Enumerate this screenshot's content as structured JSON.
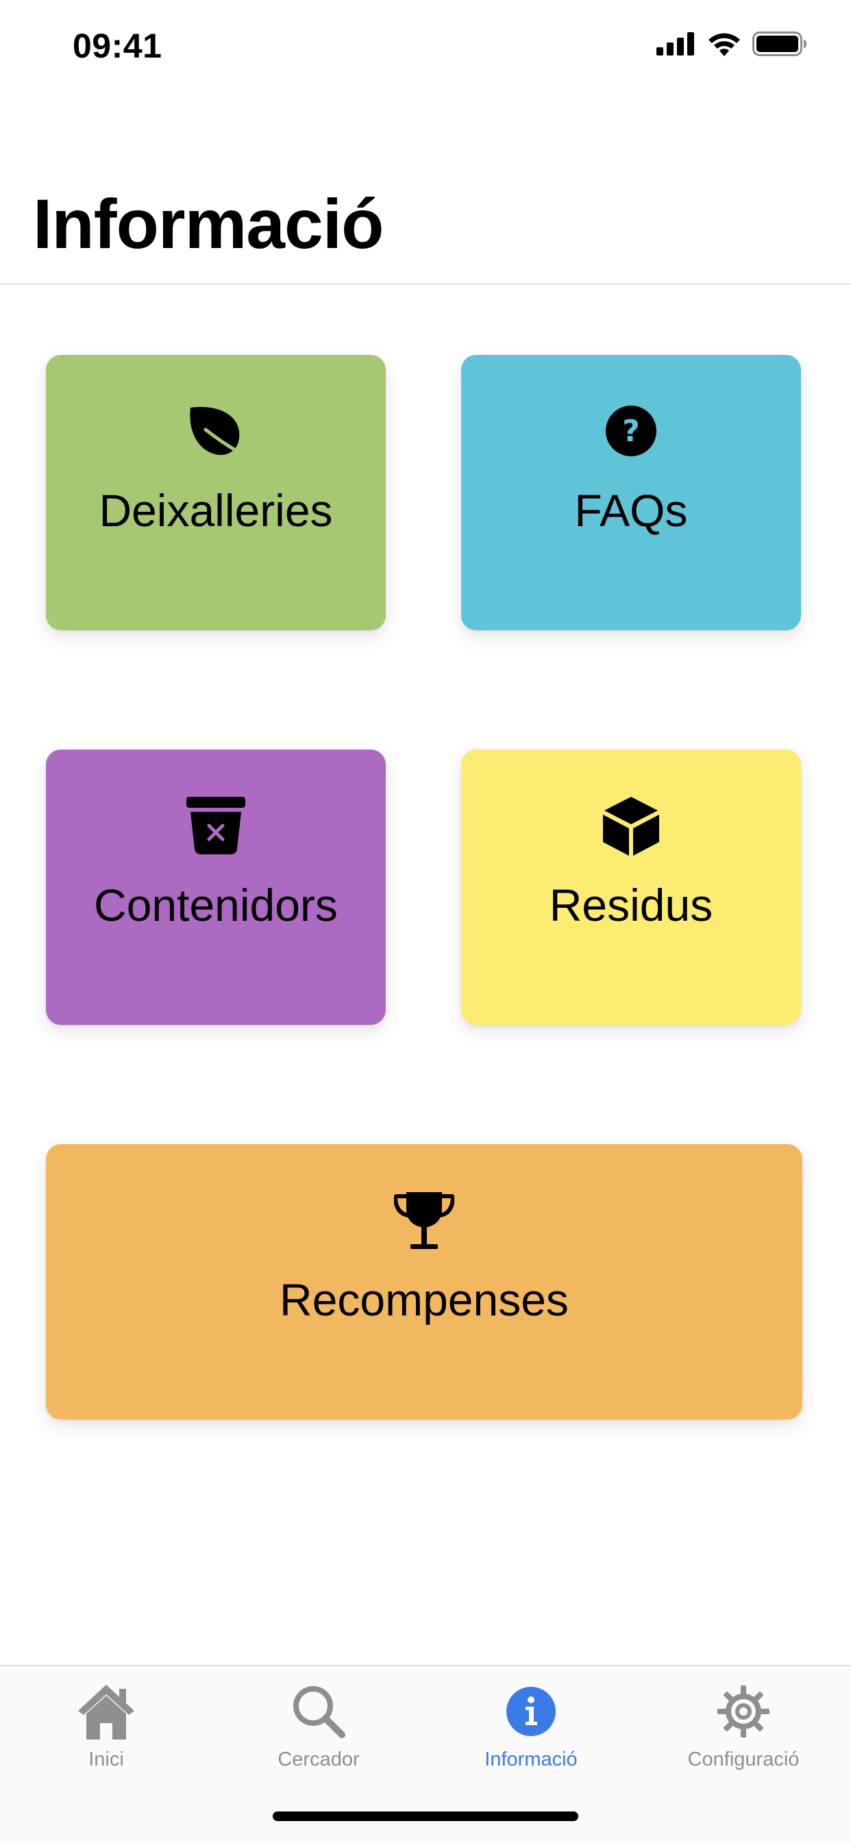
{
  "status_bar": {
    "time": "09:41",
    "icons": [
      "signal-icon",
      "wifi-icon",
      "battery-icon"
    ]
  },
  "header": {
    "title": "Informació"
  },
  "tiles": [
    {
      "label": "Deixalleries",
      "icon": "leaf-icon",
      "color": "#a6c872"
    },
    {
      "label": "FAQs",
      "icon": "question-circle-icon",
      "color": "#60c4d8"
    },
    {
      "label": "Contenidors",
      "icon": "trash-x-icon",
      "color": "#ac6ac2"
    },
    {
      "label": "Residus",
      "icon": "cube-icon",
      "color": "#fcec72"
    },
    {
      "label": "Recompenses",
      "icon": "trophy-icon",
      "color": "#f2b860"
    }
  ],
  "tab_bar": {
    "active_tab": "Informació",
    "active_color": "#3b7be8",
    "inactive_color": "#8e8e93",
    "tabs": [
      {
        "label": "Inici",
        "icon": "house-icon"
      },
      {
        "label": "Cercador",
        "icon": "magnifier-icon"
      },
      {
        "label": "Informació",
        "icon": "info-circle-icon"
      },
      {
        "label": "Configuració",
        "icon": "gear-icon"
      }
    ]
  }
}
